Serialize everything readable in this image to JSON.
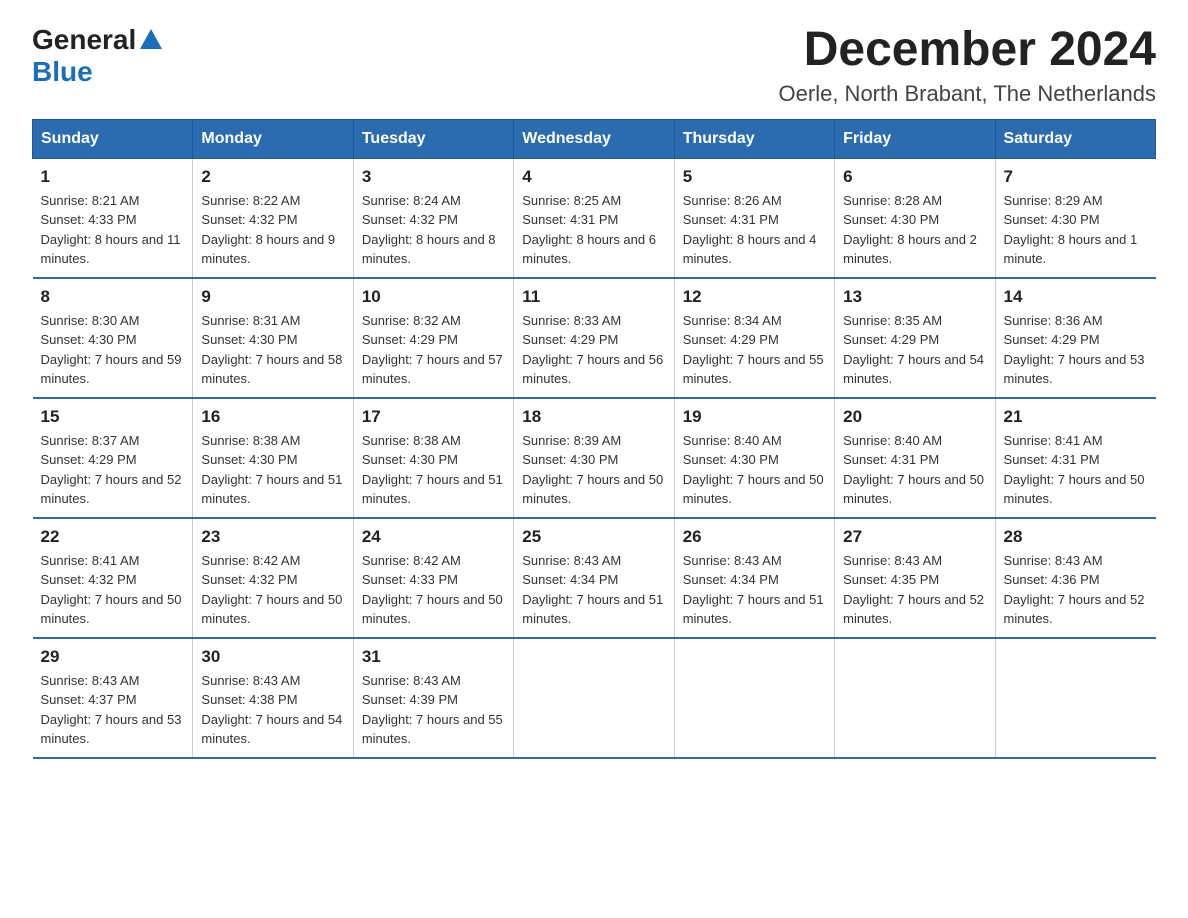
{
  "header": {
    "logo_general": "General",
    "logo_blue": "Blue",
    "title": "December 2024",
    "subtitle": "Oerle, North Brabant, The Netherlands"
  },
  "days_of_week": [
    "Sunday",
    "Monday",
    "Tuesday",
    "Wednesday",
    "Thursday",
    "Friday",
    "Saturday"
  ],
  "weeks": [
    [
      {
        "day": "1",
        "sunrise": "8:21 AM",
        "sunset": "4:33 PM",
        "daylight": "8 hours and 11 minutes."
      },
      {
        "day": "2",
        "sunrise": "8:22 AM",
        "sunset": "4:32 PM",
        "daylight": "8 hours and 9 minutes."
      },
      {
        "day": "3",
        "sunrise": "8:24 AM",
        "sunset": "4:32 PM",
        "daylight": "8 hours and 8 minutes."
      },
      {
        "day": "4",
        "sunrise": "8:25 AM",
        "sunset": "4:31 PM",
        "daylight": "8 hours and 6 minutes."
      },
      {
        "day": "5",
        "sunrise": "8:26 AM",
        "sunset": "4:31 PM",
        "daylight": "8 hours and 4 minutes."
      },
      {
        "day": "6",
        "sunrise": "8:28 AM",
        "sunset": "4:30 PM",
        "daylight": "8 hours and 2 minutes."
      },
      {
        "day": "7",
        "sunrise": "8:29 AM",
        "sunset": "4:30 PM",
        "daylight": "8 hours and 1 minute."
      }
    ],
    [
      {
        "day": "8",
        "sunrise": "8:30 AM",
        "sunset": "4:30 PM",
        "daylight": "7 hours and 59 minutes."
      },
      {
        "day": "9",
        "sunrise": "8:31 AM",
        "sunset": "4:30 PM",
        "daylight": "7 hours and 58 minutes."
      },
      {
        "day": "10",
        "sunrise": "8:32 AM",
        "sunset": "4:29 PM",
        "daylight": "7 hours and 57 minutes."
      },
      {
        "day": "11",
        "sunrise": "8:33 AM",
        "sunset": "4:29 PM",
        "daylight": "7 hours and 56 minutes."
      },
      {
        "day": "12",
        "sunrise": "8:34 AM",
        "sunset": "4:29 PM",
        "daylight": "7 hours and 55 minutes."
      },
      {
        "day": "13",
        "sunrise": "8:35 AM",
        "sunset": "4:29 PM",
        "daylight": "7 hours and 54 minutes."
      },
      {
        "day": "14",
        "sunrise": "8:36 AM",
        "sunset": "4:29 PM",
        "daylight": "7 hours and 53 minutes."
      }
    ],
    [
      {
        "day": "15",
        "sunrise": "8:37 AM",
        "sunset": "4:29 PM",
        "daylight": "7 hours and 52 minutes."
      },
      {
        "day": "16",
        "sunrise": "8:38 AM",
        "sunset": "4:30 PM",
        "daylight": "7 hours and 51 minutes."
      },
      {
        "day": "17",
        "sunrise": "8:38 AM",
        "sunset": "4:30 PM",
        "daylight": "7 hours and 51 minutes."
      },
      {
        "day": "18",
        "sunrise": "8:39 AM",
        "sunset": "4:30 PM",
        "daylight": "7 hours and 50 minutes."
      },
      {
        "day": "19",
        "sunrise": "8:40 AM",
        "sunset": "4:30 PM",
        "daylight": "7 hours and 50 minutes."
      },
      {
        "day": "20",
        "sunrise": "8:40 AM",
        "sunset": "4:31 PM",
        "daylight": "7 hours and 50 minutes."
      },
      {
        "day": "21",
        "sunrise": "8:41 AM",
        "sunset": "4:31 PM",
        "daylight": "7 hours and 50 minutes."
      }
    ],
    [
      {
        "day": "22",
        "sunrise": "8:41 AM",
        "sunset": "4:32 PM",
        "daylight": "7 hours and 50 minutes."
      },
      {
        "day": "23",
        "sunrise": "8:42 AM",
        "sunset": "4:32 PM",
        "daylight": "7 hours and 50 minutes."
      },
      {
        "day": "24",
        "sunrise": "8:42 AM",
        "sunset": "4:33 PM",
        "daylight": "7 hours and 50 minutes."
      },
      {
        "day": "25",
        "sunrise": "8:43 AM",
        "sunset": "4:34 PM",
        "daylight": "7 hours and 51 minutes."
      },
      {
        "day": "26",
        "sunrise": "8:43 AM",
        "sunset": "4:34 PM",
        "daylight": "7 hours and 51 minutes."
      },
      {
        "day": "27",
        "sunrise": "8:43 AM",
        "sunset": "4:35 PM",
        "daylight": "7 hours and 52 minutes."
      },
      {
        "day": "28",
        "sunrise": "8:43 AM",
        "sunset": "4:36 PM",
        "daylight": "7 hours and 52 minutes."
      }
    ],
    [
      {
        "day": "29",
        "sunrise": "8:43 AM",
        "sunset": "4:37 PM",
        "daylight": "7 hours and 53 minutes."
      },
      {
        "day": "30",
        "sunrise": "8:43 AM",
        "sunset": "4:38 PM",
        "daylight": "7 hours and 54 minutes."
      },
      {
        "day": "31",
        "sunrise": "8:43 AM",
        "sunset": "4:39 PM",
        "daylight": "7 hours and 55 minutes."
      },
      null,
      null,
      null,
      null
    ]
  ],
  "labels": {
    "sunrise": "Sunrise:",
    "sunset": "Sunset:",
    "daylight": "Daylight:"
  }
}
